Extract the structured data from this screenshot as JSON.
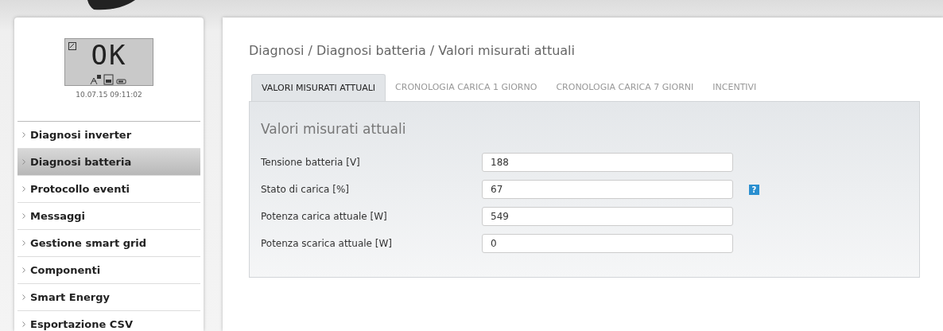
{
  "display": {
    "status": "OK",
    "datetime": "10.07.15 09:11:02"
  },
  "sidebar": {
    "items": [
      {
        "label": "Diagnosi inverter",
        "selected": false
      },
      {
        "label": "Diagnosi batteria",
        "selected": true
      },
      {
        "label": "Protocollo eventi",
        "selected": false
      },
      {
        "label": "Messaggi",
        "selected": false
      },
      {
        "label": "Gestione smart grid",
        "selected": false
      },
      {
        "label": "Componenti",
        "selected": false
      },
      {
        "label": "Smart Energy",
        "selected": false
      },
      {
        "label": "Esportazione CSV",
        "selected": false
      }
    ]
  },
  "breadcrumb": "Diagnosi / Diagnosi batteria / Valori misurati attuali",
  "tabs": [
    {
      "label": "VALORI MISURATI ATTUALI",
      "selected": true
    },
    {
      "label": "CRONOLOGIA CARICA 1 GIORNO",
      "selected": false
    },
    {
      "label": "CRONOLOGIA CARICA 7 GIORNI",
      "selected": false
    },
    {
      "label": "INCENTIVI",
      "selected": false
    }
  ],
  "panel": {
    "title": "Valori misurati attuali",
    "rows": [
      {
        "label": "Tensione batteria [V]",
        "value": "188"
      },
      {
        "label": "Stato di carica [%]",
        "value": "67",
        "help": "?"
      },
      {
        "label": "Potenza carica attuale [W]",
        "value": "549"
      },
      {
        "label": "Potenza scarica attuale [W]",
        "value": "0"
      }
    ]
  }
}
